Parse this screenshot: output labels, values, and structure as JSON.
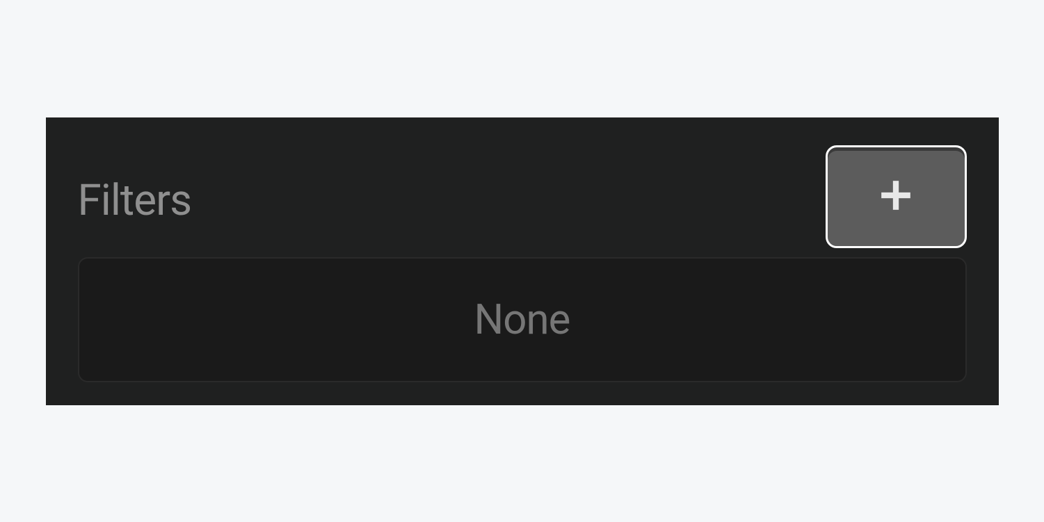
{
  "filters": {
    "title": "Filters",
    "empty_state": "None"
  }
}
